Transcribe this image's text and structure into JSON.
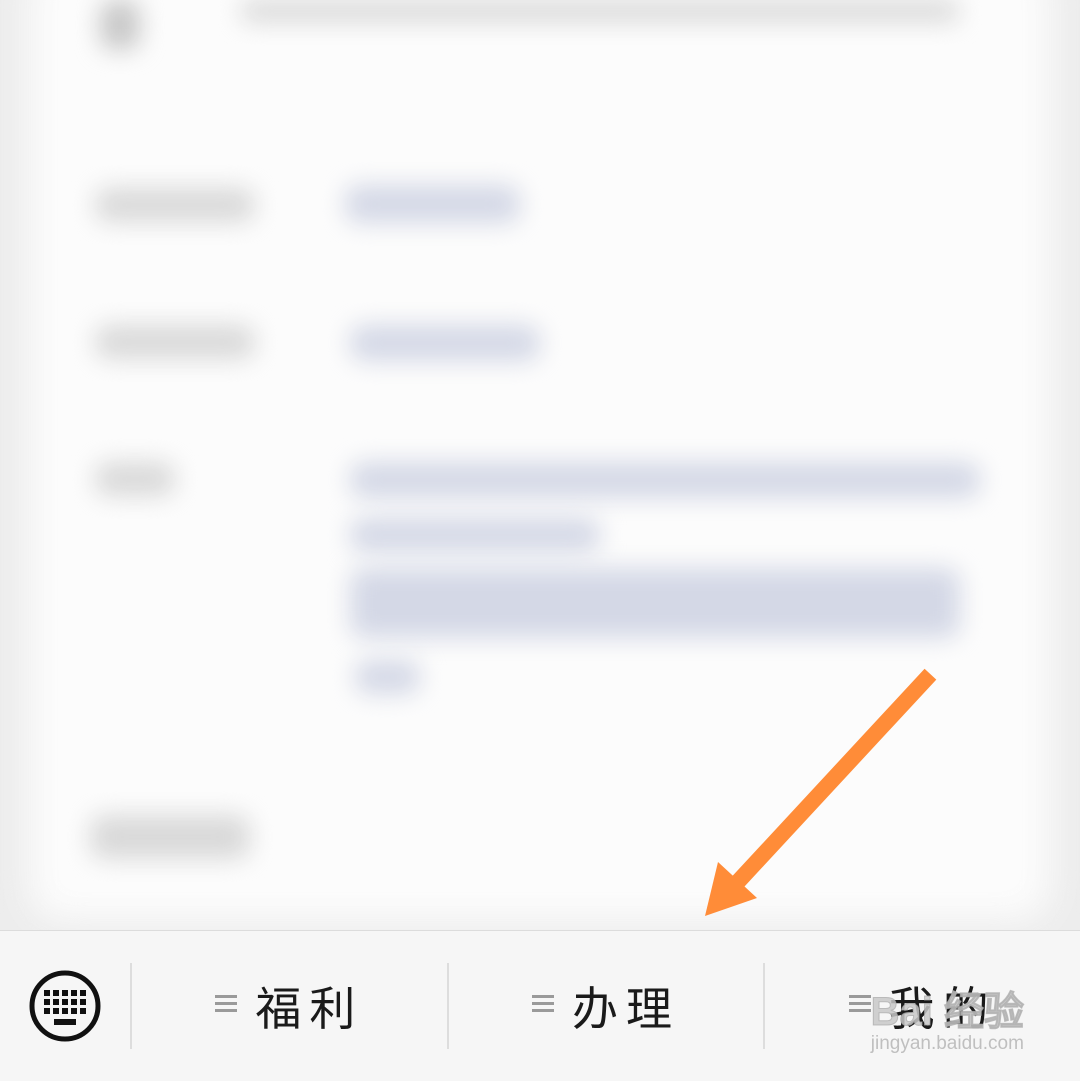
{
  "menubar": {
    "keyboard_icon": "keyboard-icon",
    "items": [
      {
        "label": "福利",
        "icon": "menu-lines-icon"
      },
      {
        "label": "办理",
        "icon": "menu-lines-icon"
      },
      {
        "label": "我的",
        "icon": "menu-lines-icon"
      }
    ]
  },
  "annotation": {
    "arrow_color": "#ff8c38"
  },
  "watermark": {
    "logo": "Bai 经验",
    "url": "jingyan.baidu.com"
  }
}
